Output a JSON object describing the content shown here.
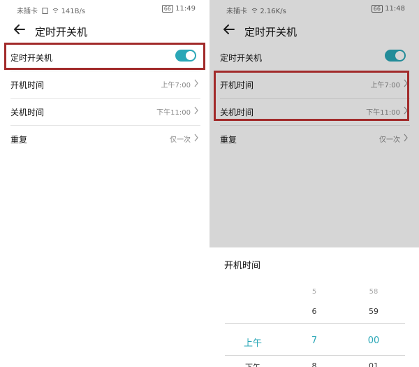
{
  "left": {
    "status": {
      "carrier": "未插卡",
      "speed": "141B/s",
      "battery": "66",
      "time": "11:49"
    },
    "header": {
      "title": "定时开关机"
    },
    "rows": [
      {
        "label": "定时开关机",
        "toggle": "on"
      },
      {
        "label": "开机时间",
        "value": "上午7:00"
      },
      {
        "label": "关机时间",
        "value": "下午11:00"
      },
      {
        "label": "重复",
        "value": "仅一次"
      }
    ]
  },
  "right": {
    "status": {
      "carrier": "未插卡",
      "speed": "2.16K/s",
      "battery": "66",
      "time": "11:48"
    },
    "header": {
      "title": "定时开关机"
    },
    "rows": [
      {
        "label": "定时开关机",
        "toggle": "on"
      },
      {
        "label": "开机时间",
        "value": "上午7:00"
      },
      {
        "label": "关机时间",
        "value": "下午11:00"
      },
      {
        "label": "重复",
        "value": "仅一次"
      }
    ],
    "sheet": {
      "title": "开机时间",
      "picker": {
        "ampm": {
          "selected": "上午",
          "next": "下午"
        },
        "hour": {
          "prev2": "5",
          "prev1": "6",
          "selected": "7",
          "next": "8"
        },
        "minute": {
          "prev2": "58",
          "prev1": "59",
          "selected": "00",
          "next": "01"
        }
      }
    }
  },
  "colors": {
    "accent": "#2aa7b7",
    "highlight": "#a22b2b"
  }
}
